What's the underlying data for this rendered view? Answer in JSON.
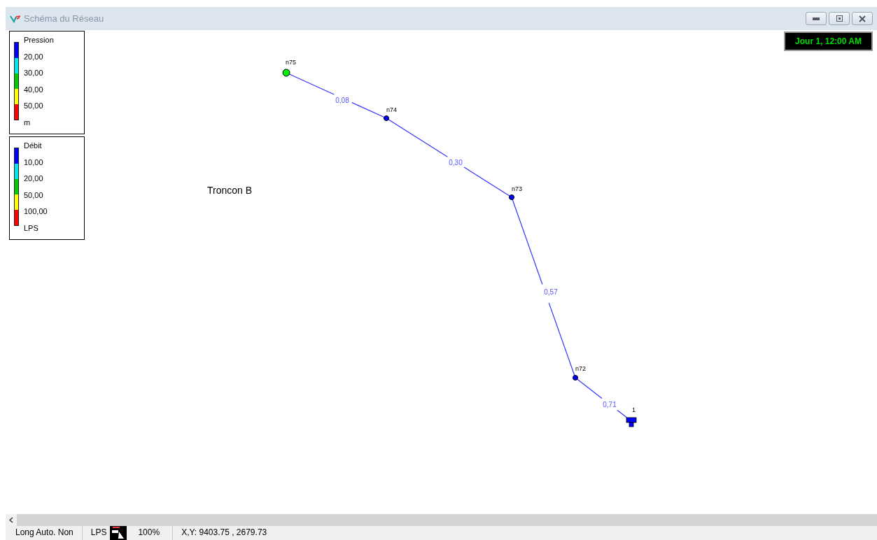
{
  "window": {
    "title": "Schéma du Réseau"
  },
  "legends": [
    {
      "title": "Pression",
      "thresholds": [
        "20,00",
        "30,00",
        "40,00",
        "50,00"
      ],
      "unit": "m",
      "bands": [
        {
          "color": "#0000ff"
        },
        {
          "color": "#00e5ee"
        },
        {
          "color": "#00cc00"
        },
        {
          "color": "#ffff00"
        },
        {
          "color": "#ff0000"
        }
      ]
    },
    {
      "title": "Débit",
      "thresholds": [
        "10,00",
        "20,00",
        "50,00",
        "100,00"
      ],
      "unit": "LPS",
      "bands": [
        {
          "color": "#0000ff"
        },
        {
          "color": "#00e5ee"
        },
        {
          "color": "#00cc00"
        },
        {
          "color": "#ffff00"
        },
        {
          "color": "#ff0000"
        }
      ]
    }
  ],
  "clock": "Jour 1, 12:00 AM",
  "map_label": "Troncon B",
  "nodes": [
    {
      "label": "n75",
      "kind": "junction",
      "color": "#00ee00"
    },
    {
      "label": "n74",
      "kind": "junction",
      "color": "#0000ff"
    },
    {
      "label": "n73",
      "kind": "junction",
      "color": "#0000ff"
    },
    {
      "label": "n72",
      "kind": "junction",
      "color": "#0000ff"
    },
    {
      "label": "1",
      "kind": "tank",
      "color": "#0000ff"
    }
  ],
  "pipes": [
    {
      "value": "0,08"
    },
    {
      "value": "0,30"
    },
    {
      "value": "0,57"
    },
    {
      "value": "0,71"
    }
  ],
  "status_bar": [
    "Long Auto. Non",
    "LPS",
    "100%",
    "X,Y: 9403.75 , 2679.73"
  ]
}
